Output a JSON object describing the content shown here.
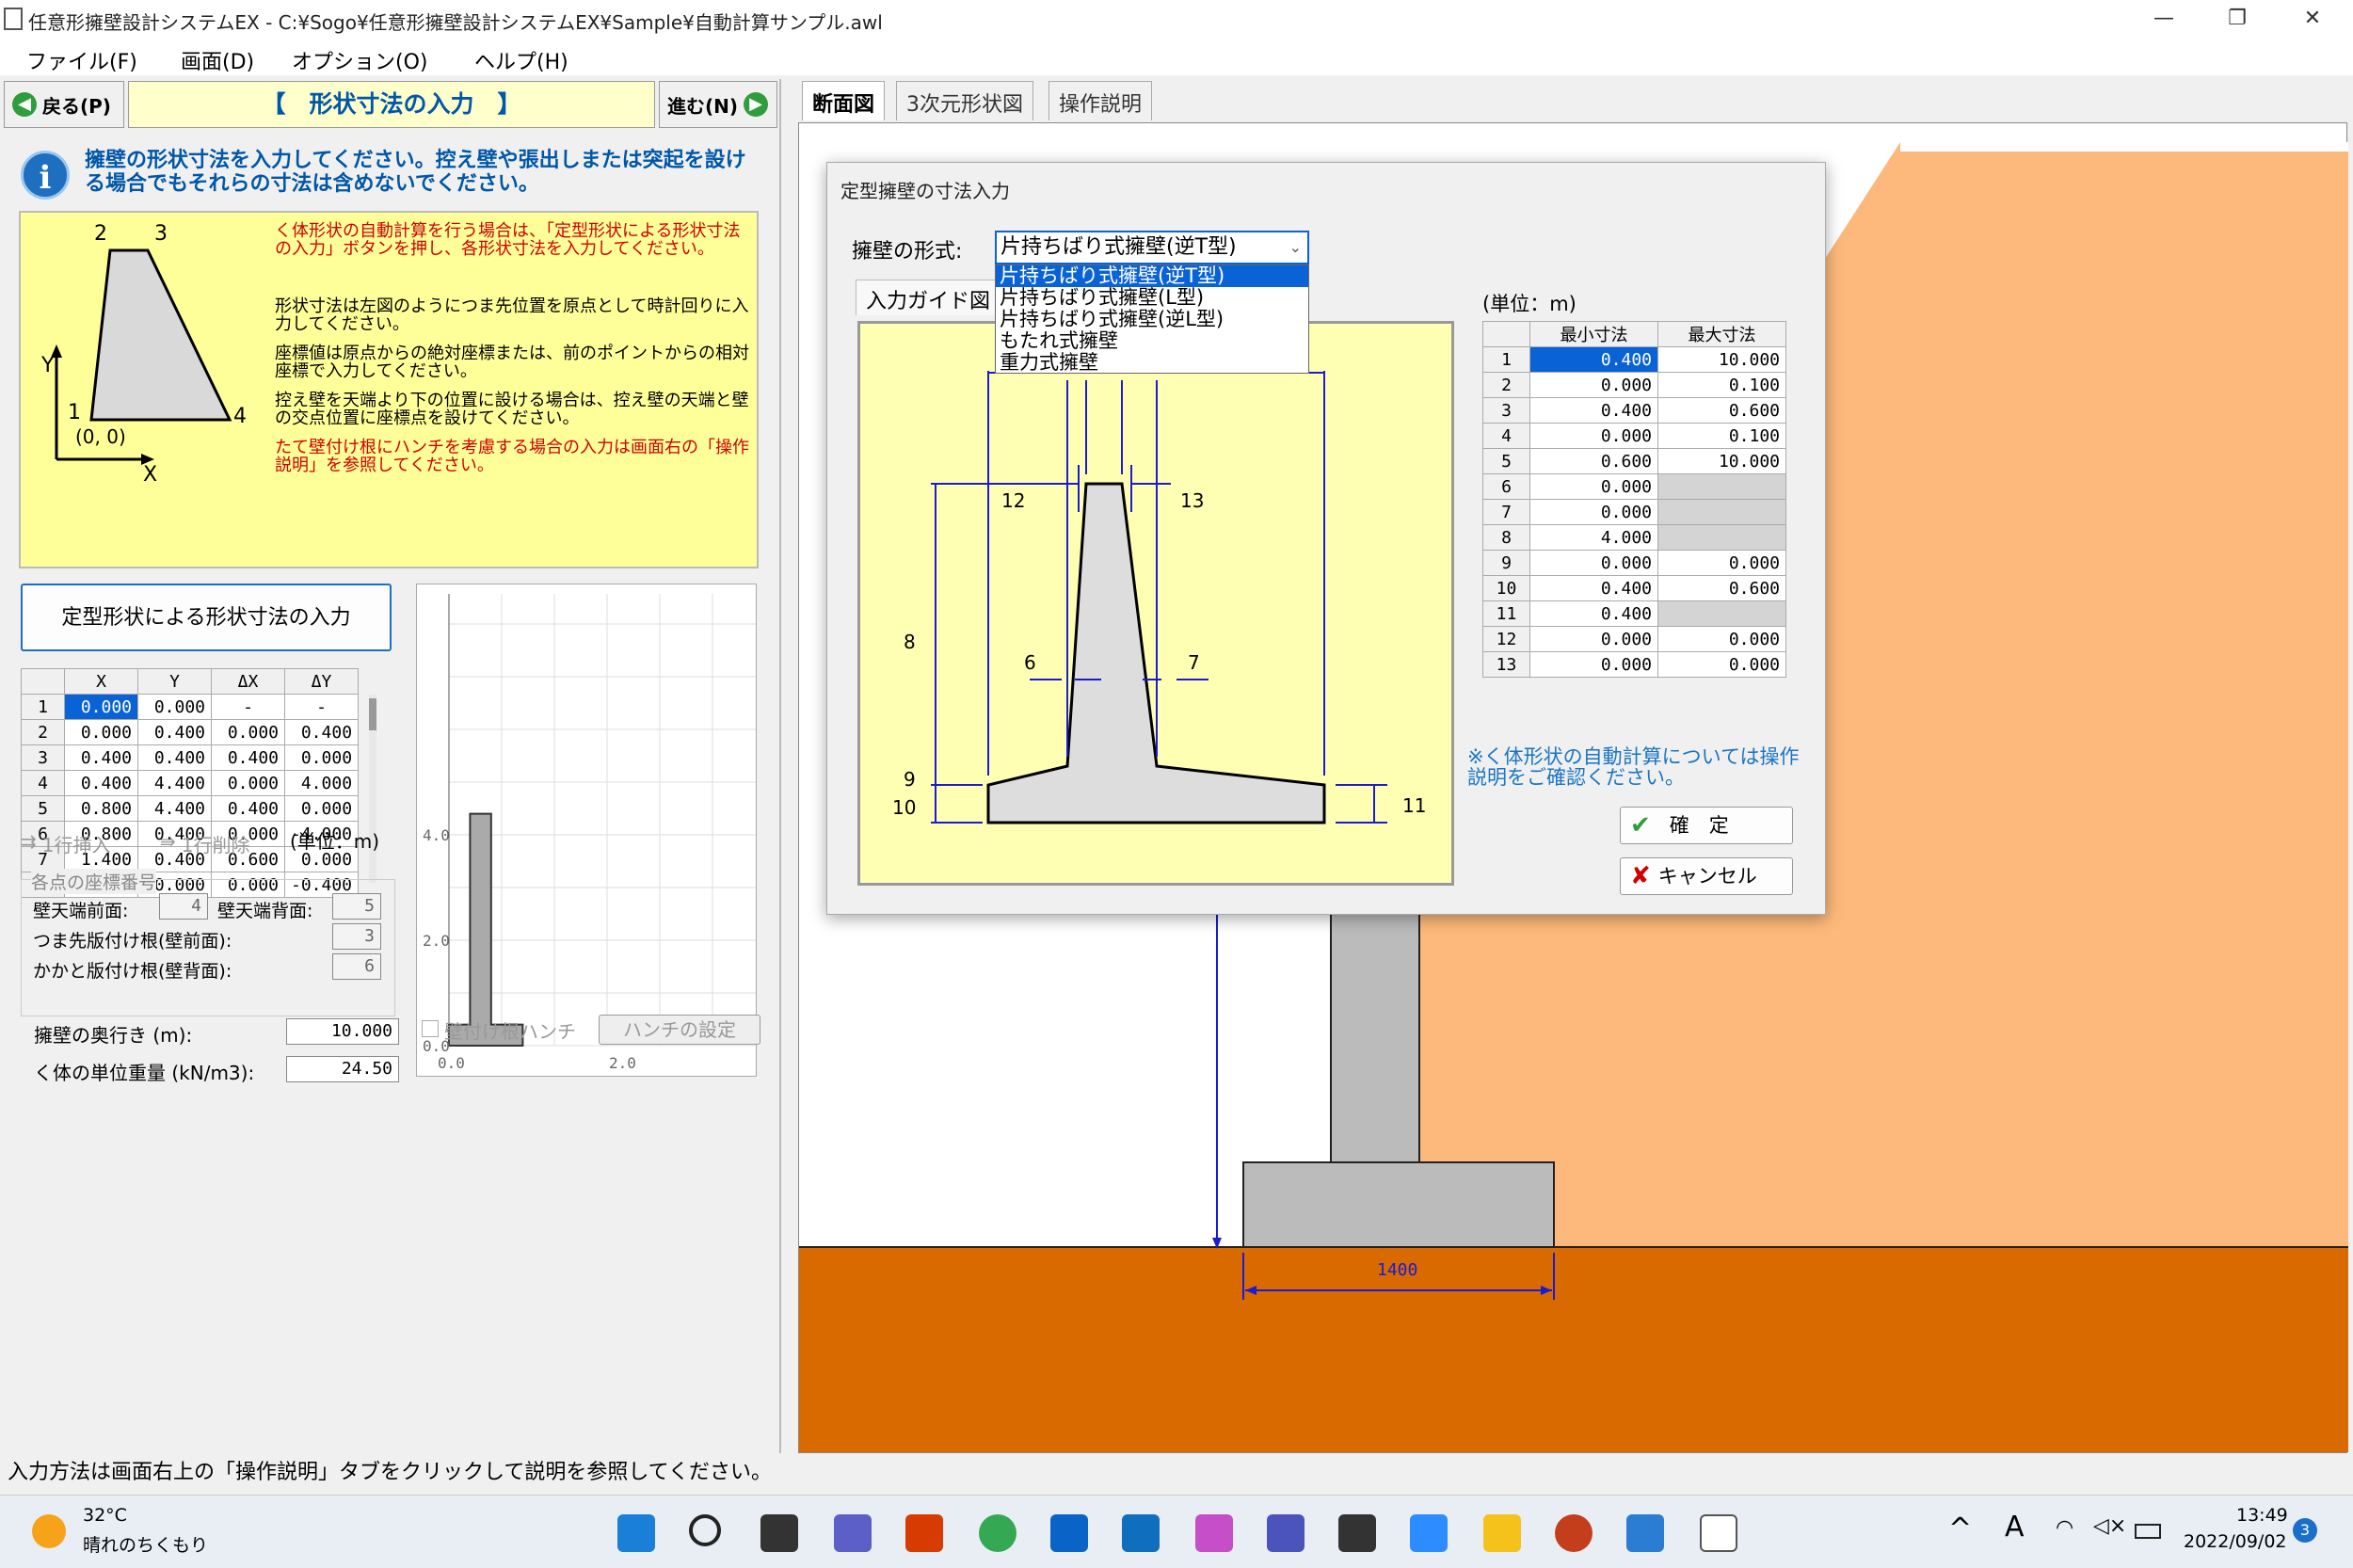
{
  "window": {
    "title": "任意形擁壁設計システムEX - C:¥Sogo¥任意形擁壁設計システムEX¥Sample¥自動計算サンプル.awl",
    "minimize": "—",
    "restore": "❐",
    "close": "✕"
  },
  "menu": [
    "ファイル(F)",
    "画面(D)",
    "オプション(O)",
    "ヘルプ(H)"
  ],
  "nav": {
    "back": "戻る(P)",
    "next": "進む(N)",
    "step_title": "【　形状寸法の入力　】"
  },
  "info": {
    "text": "擁壁の形状寸法を入力してください。控え壁や張出しまたは突起を設ける場合でもそれらの寸法は含めないでください。"
  },
  "guide": {
    "p1": "く体形状の自動計算を行う場合は、「定型形状による形状寸法の入力」ボタンを押し、各形状寸法を入力してください。",
    "p2": "形状寸法は左図のようにつま先位置を原点として時計回りに入力してください。",
    "p3": "座標値は原点からの絶対座標または、前のポイントからの相対座標で入力してください。",
    "p4": "控え壁を天端より下の位置に設ける場合は、控え壁の天端と壁の交点位置に座標点を設けてください。",
    "p5": "たて壁付け根にハンチを考慮する場合の入力は画面右の「操作説明」を参照してください。",
    "labels": {
      "p1": "1",
      "p2": "2",
      "p3": "3",
      "p4": "4",
      "origin": "(0, 0)",
      "x": "X",
      "y": "Y"
    }
  },
  "teikei_button": "定型形状による形状寸法の入力",
  "coords": {
    "headers": [
      "X",
      "Y",
      "ΔX",
      "ΔY"
    ],
    "rows": [
      [
        "1",
        "0.000",
        "0.000",
        "-",
        "-"
      ],
      [
        "2",
        "0.000",
        "0.400",
        "0.000",
        "0.400"
      ],
      [
        "3",
        "0.400",
        "0.400",
        "0.400",
        "0.000"
      ],
      [
        "4",
        "0.400",
        "4.400",
        "0.000",
        "4.000"
      ],
      [
        "5",
        "0.800",
        "4.400",
        "0.400",
        "0.000"
      ],
      [
        "6",
        "0.800",
        "0.400",
        "0.000",
        "-4.000"
      ],
      [
        "7",
        "1.400",
        "0.400",
        "0.600",
        "0.000"
      ],
      [
        "8",
        "1.400",
        "0.000",
        "0.000",
        "-0.400"
      ]
    ]
  },
  "row_buttons": {
    "insert": "1行挿入",
    "delete": "1行削除",
    "unit": "(単位：m)"
  },
  "coord_numbers": {
    "group": "各点の座標番号",
    "front_top_label": "壁天端前面:",
    "front_top": "4",
    "back_top_label": "壁天端背面:",
    "back_top": "5",
    "toe_label": "つま先版付け根(壁前面):",
    "toe": "3",
    "heel_label": "かかと版付け根(壁背面):",
    "heel": "6"
  },
  "depth": {
    "label": "擁壁の奥行き (m):",
    "value": "10.000"
  },
  "weight": {
    "label": "く体の単位重量 (kN/m3):",
    "value": "24.50"
  },
  "haunch": {
    "checkbox": "壁付け根ハンチ",
    "button": "ハンチの設定"
  },
  "minichart": {
    "ticks_y": [
      "4.0",
      "2.0",
      "0.0"
    ],
    "ticks_x": [
      "0.0",
      "2.0"
    ]
  },
  "tabs": [
    "断面図",
    "3次元形状図",
    "操作説明"
  ],
  "canvas": {
    "dim_label": "1400"
  },
  "dialog": {
    "title": "定型擁壁の寸法入力",
    "type_label": "擁壁の形式:",
    "selected": "片持ちばり式擁壁(逆T型)",
    "options": [
      "片持ちばり式擁壁(逆T型)",
      "片持ちばり式擁壁(L型)",
      "片持ちばり式擁壁(逆L型)",
      "もたれ式擁壁",
      "重力式擁壁"
    ],
    "guide_tab": "入力ガイド図",
    "dim_labels": [
      "12",
      "13",
      "8",
      "6",
      "7",
      "9",
      "10",
      "11"
    ],
    "unit": "(単位：m)",
    "table_headers": [
      "最小寸法",
      "最大寸法"
    ],
    "table_rows": [
      [
        "1",
        "0.400",
        "10.000"
      ],
      [
        "2",
        "0.000",
        "0.100"
      ],
      [
        "3",
        "0.400",
        "0.600"
      ],
      [
        "4",
        "0.000",
        "0.100"
      ],
      [
        "5",
        "0.600",
        "10.000"
      ],
      [
        "6",
        "0.000",
        ""
      ],
      [
        "7",
        "0.000",
        ""
      ],
      [
        "8",
        "4.000",
        ""
      ],
      [
        "9",
        "0.000",
        "0.000"
      ],
      [
        "10",
        "0.400",
        "0.600"
      ],
      [
        "11",
        "0.400",
        ""
      ],
      [
        "12",
        "0.000",
        "0.000"
      ],
      [
        "13",
        "0.000",
        "0.000"
      ]
    ],
    "note": "※く体形状の自動計算については操作説明をご確認ください。",
    "ok": "確　定",
    "cancel": "キャンセル"
  },
  "status": "入力方法は画面右上の「操作説明」タブをクリックして説明を参照してください。",
  "taskbar": {
    "temp": "32°C",
    "weather": "晴れのちくもり",
    "time": "13:49",
    "date": "2022/09/02",
    "badge": "3",
    "ime": "A"
  }
}
